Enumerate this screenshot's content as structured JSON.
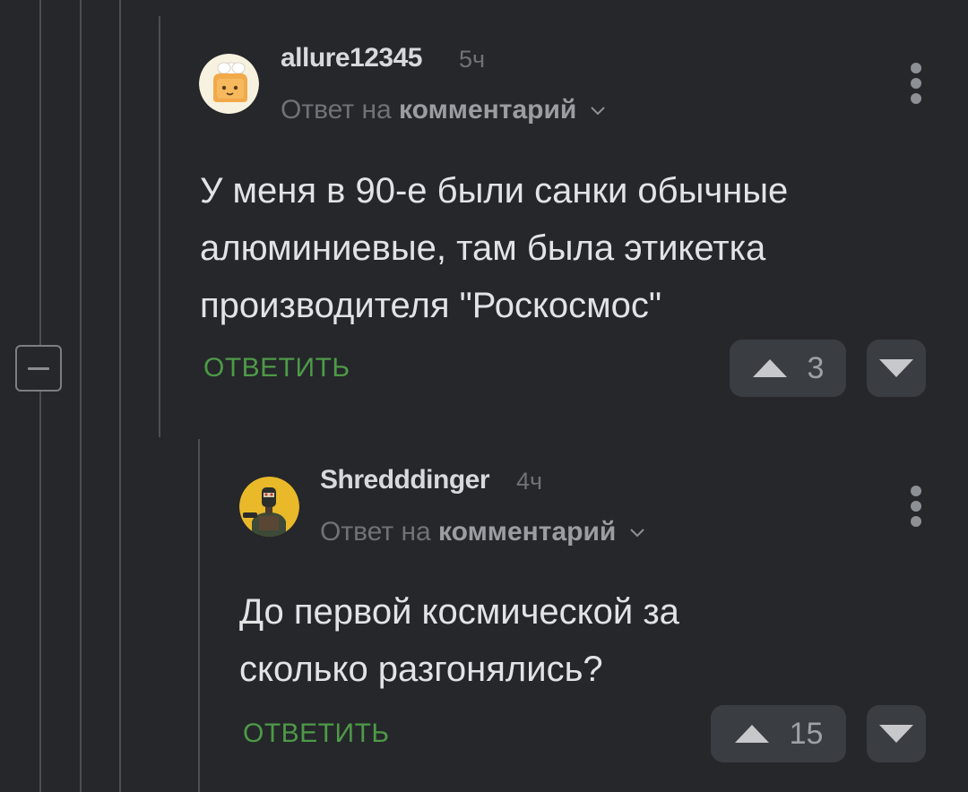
{
  "comments": [
    {
      "username": "allure12345",
      "time": "5ч",
      "reply_prefix": "Ответ на",
      "reply_target": "комментарий",
      "text": "У меня в 90-е были санки обычные\nалюминиевые, там была этикетка\nпроизводителя \"Роскосмос\"",
      "reply_label": "ОТВЕТИТЬ",
      "rating": "3",
      "avatar_icon": "chef-toast-avatar"
    },
    {
      "username": "Shredddinger",
      "time": "4ч",
      "reply_prefix": "Ответ на",
      "reply_target": "комментарий",
      "text": "До первой космической за\nсколько разгонялись?",
      "reply_label": "ОТВЕТИТЬ",
      "rating": "15",
      "avatar_icon": "armored-soldier-avatar"
    }
  ],
  "colors": {
    "background": "#25272b",
    "accent_green": "#4e9a47",
    "button_bg": "#3a3d42",
    "thread_line": "#4b4e53"
  },
  "icons": {
    "collapse": "minus-square-icon",
    "menu": "vertical-dots-icon",
    "upvote": "triangle-up-icon",
    "downvote": "triangle-down-icon",
    "expand": "chevron-down-icon"
  }
}
